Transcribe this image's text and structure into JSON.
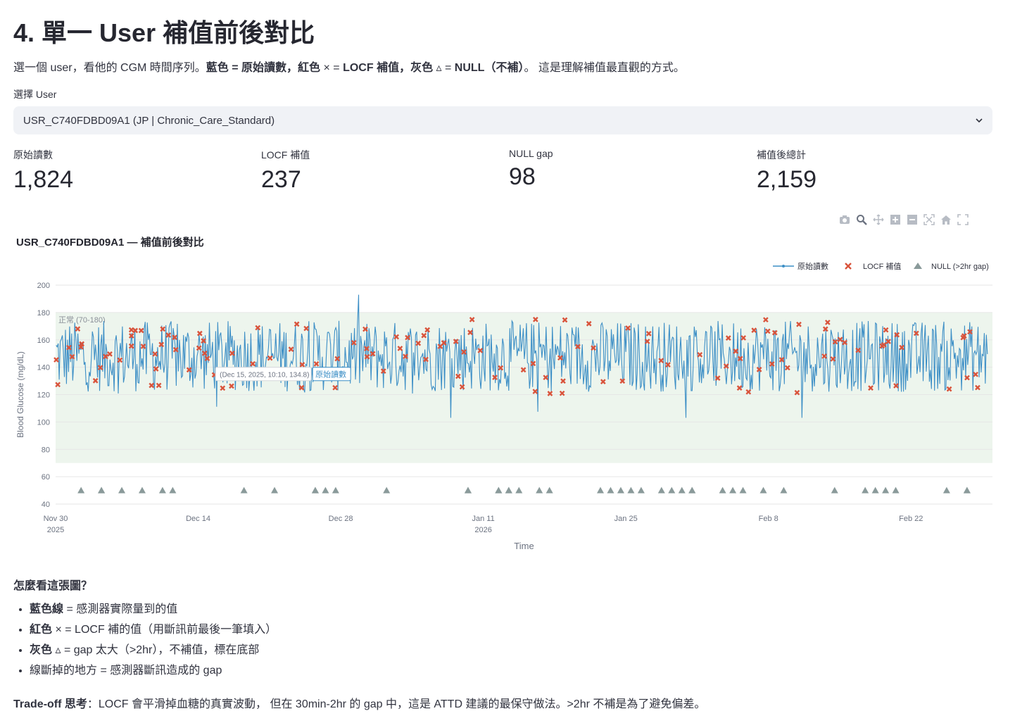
{
  "page": {
    "title": "4. 單一 User 補值前後對比",
    "intro": {
      "p1": "選一個 user，看他的 CGM 時間序列。",
      "b1": "藍色 = 原始讀數，紅色",
      "p2": " × = ",
      "b2": "LOCF 補值，灰色",
      "p3": " ▵ = ",
      "b3": "NULL（不補）",
      "p4": "。 這是理解補值最直觀的方式。"
    }
  },
  "user_select": {
    "label": "選擇 User",
    "value": "USR_C740FDBD09A1 (JP | Chronic_Care_Standard)"
  },
  "metrics": [
    {
      "label": "原始讀數",
      "value": "1,824"
    },
    {
      "label": "LOCF 補值",
      "value": "237"
    },
    {
      "label": "NULL gap",
      "value": "98"
    },
    {
      "label": "補值後總計",
      "value": "2,159"
    }
  ],
  "modebar_icons": [
    "camera-icon",
    "zoom-icon",
    "pan-icon",
    "zoom-in-icon",
    "zoom-out-icon",
    "autoscale-icon",
    "home-icon",
    "fullscreen-icon"
  ],
  "chart_data": {
    "type": "line",
    "title": "USR_C740FDBD09A1 — 補值前後對比",
    "xlabel": "Time",
    "ylabel": "Blood Glucose (mg/dL)",
    "ylim": [
      40,
      200
    ],
    "yticks": [
      200,
      180,
      160,
      140,
      120,
      100,
      80,
      60,
      40
    ],
    "xlim": [
      "2025-11-30",
      "2026-03-02"
    ],
    "xticks": [
      {
        "date": "2025-11-30",
        "label": "Nov 30",
        "sublabel": "2025"
      },
      {
        "date": "2025-12-14",
        "label": "Dec 14",
        "sublabel": ""
      },
      {
        "date": "2025-12-28",
        "label": "Dec 28",
        "sublabel": ""
      },
      {
        "date": "2026-01-11",
        "label": "Jan 11",
        "sublabel": "2026"
      },
      {
        "date": "2026-01-25",
        "label": "Jan 25",
        "sublabel": ""
      },
      {
        "date": "2026-02-08",
        "label": "Feb 8",
        "sublabel": ""
      },
      {
        "date": "2026-02-22",
        "label": "Feb 22",
        "sublabel": ""
      }
    ],
    "normal_band": {
      "low": 70,
      "high": 180,
      "label": "正常 (70-180)"
    },
    "legend_position": "top-right",
    "grid": true,
    "series": [
      {
        "name": "原始讀數",
        "kind": "line+markers",
        "color": "#3d8fc6",
        "count": 1824,
        "values_note": "approx. 1,824 readings fluctuating between about 103 and 193 mg/dL, mostly 125–170"
      },
      {
        "name": "LOCF 補值",
        "kind": "x-markers",
        "color": "#d9533b",
        "count": 237
      },
      {
        "name": "NULL (>2hr gap)",
        "kind": "triangle-markers",
        "color": "#8a9a9a",
        "count": 98,
        "y": 50,
        "dates": [
          "2025-12-02",
          "2025-12-04",
          "2025-12-04",
          "2025-12-06",
          "2025-12-08",
          "2025-12-10",
          "2025-12-11",
          "2025-12-18",
          "2025-12-21",
          "2025-12-25",
          "2025-12-25",
          "2025-12-26",
          "2025-12-27",
          "2026-01-01",
          "2026-01-09",
          "2026-01-09",
          "2026-01-12",
          "2026-01-12",
          "2026-01-13",
          "2026-01-13",
          "2026-01-14",
          "2026-01-16",
          "2026-01-17",
          "2026-01-22",
          "2026-01-23",
          "2026-01-24",
          "2026-01-25",
          "2026-01-26",
          "2026-01-28",
          "2026-01-29",
          "2026-01-30",
          "2026-01-31",
          "2026-01-31",
          "2026-02-03",
          "2026-02-04",
          "2026-02-05",
          "2026-02-07",
          "2026-02-09",
          "2026-02-14",
          "2026-02-17",
          "2026-02-18",
          "2026-02-19",
          "2026-02-20",
          "2026-02-25",
          "2026-02-27",
          "2026-02-27"
        ]
      }
    ],
    "hover": {
      "text": "(Dec 15, 2025, 10:10, 134.8)",
      "series": "原始讀數",
      "date": "2025-12-15T10:10",
      "value": 134.8
    }
  },
  "explain": {
    "heading": "怎麼看這張圖？",
    "items": [
      {
        "bold": "藍色線",
        "text": " = 感測器實際量到的值"
      },
      {
        "bold": "紅色",
        "text": " × = LOCF 補的值（用斷訊前最後一筆填入）"
      },
      {
        "bold": "灰色",
        "text": " ▵ = gap 太大（>2hr），不補值，標在底部"
      },
      {
        "bold": "",
        "text": "線斷掉的地方 = 感測器斷訊造成的 gap"
      }
    ],
    "tradeoff_bold": "Trade-off 思考",
    "tradeoff_text": "：LOCF 會平滑掉血糖的真實波動， 但在 30min-2hr 的 gap 中，這是 ATTD 建議的最保守做法。>2hr 不補是為了避免偏差。"
  }
}
